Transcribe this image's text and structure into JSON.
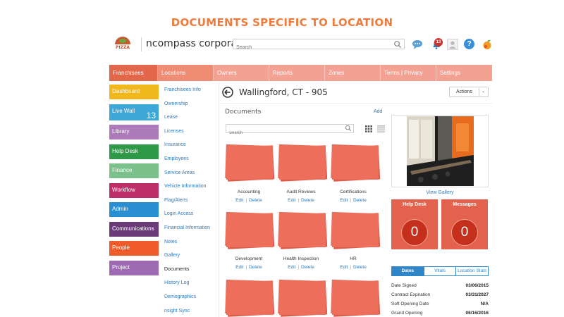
{
  "slide_title": "DOCUMENTS SPECIFIC TO LOCATION",
  "header": {
    "logo_text": "PIZZA",
    "brand": "ncompass corporate",
    "search_placeholder": "Search",
    "notification_count": "13",
    "help_label": "?"
  },
  "nav": {
    "items": [
      {
        "label": "Franchisees"
      },
      {
        "label": "Locations"
      },
      {
        "label": "Owners"
      },
      {
        "label": "Reports"
      },
      {
        "label": "Zones"
      },
      {
        "label": "Terms | Privacy"
      },
      {
        "label": "Settings"
      }
    ]
  },
  "left_menu": {
    "items": [
      {
        "label": "Dashboard",
        "color": "#f0b81d"
      },
      {
        "label": "Live Wall",
        "color": "#3fa6d8",
        "count": "13"
      },
      {
        "label": "Library",
        "color": "#ad7bb9"
      },
      {
        "label": "Help Desk",
        "color": "#2e9a47"
      },
      {
        "label": "Finance",
        "color": "#7cc08c"
      },
      {
        "label": "Workflow",
        "color": "#bd2d67"
      },
      {
        "label": "Admin",
        "color": "#2a8fd2"
      },
      {
        "label": "Communications",
        "color": "#6a3b78"
      },
      {
        "label": "People",
        "color": "#ef5a2a"
      },
      {
        "label": "Project",
        "color": "#9e6ab1"
      }
    ]
  },
  "sub_menu": {
    "items": [
      {
        "label": "Franchisees Info"
      },
      {
        "label": "Ownership"
      },
      {
        "label": "Lease"
      },
      {
        "label": "Licenses"
      },
      {
        "label": "Insurance"
      },
      {
        "label": "Employees"
      },
      {
        "label": "Service Areas"
      },
      {
        "label": "Vehicle Information"
      },
      {
        "label": "Flag/Alerts"
      },
      {
        "label": "Login Access"
      },
      {
        "label": "Financial Information"
      },
      {
        "label": "Notes"
      },
      {
        "label": "Gallery"
      },
      {
        "label": "Documents"
      },
      {
        "label": "History Log"
      },
      {
        "label": "Demographics"
      },
      {
        "label": "nsight Sync"
      }
    ],
    "current": "Documents"
  },
  "main": {
    "location_title": "Wallingford, CT - 905",
    "actions_label": "Actions",
    "documents_label": "Documents",
    "add_label": "Add",
    "search_placeholder": "Search",
    "folders": [
      {
        "name": "Accounting"
      },
      {
        "name": "Audit Reviews"
      },
      {
        "name": "Certifications"
      },
      {
        "name": "Development"
      },
      {
        "name": "Health Inspection"
      },
      {
        "name": "HR"
      }
    ],
    "edit_label": "Edit",
    "delete_label": "Delete"
  },
  "right": {
    "view_gallery": "View Gallery",
    "help_desk": {
      "label": "Help Desk",
      "count": "0"
    },
    "messages": {
      "label": "Messages",
      "count": "0"
    },
    "tabs": [
      {
        "label": "Dates"
      },
      {
        "label": "Vitals"
      },
      {
        "label": "Location Stats"
      }
    ],
    "dates": [
      {
        "label": "Date Signed",
        "value": "03/06/2015"
      },
      {
        "label": "Contract Expiration",
        "value": "03/31/2027"
      },
      {
        "label": "Soft Opening Date",
        "value": "N/A"
      },
      {
        "label": "Grand Opening",
        "value": "06/16/2016"
      }
    ]
  },
  "colors": {
    "accent_orange": "#ee7b3b",
    "folder": "#ec6e5b",
    "tile": "#e2624e",
    "link": "#2a7ac0",
    "tab_blue": "#2e86c9"
  }
}
